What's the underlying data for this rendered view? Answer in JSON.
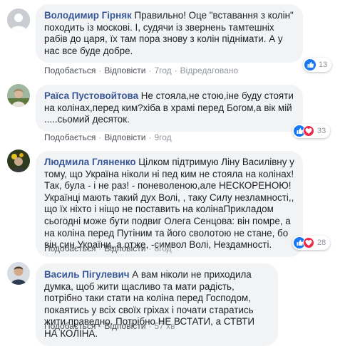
{
  "action_labels": {
    "like": "Подобається",
    "reply": "Відповісти",
    "edited": "Відредаговано"
  },
  "comments": [
    {
      "author": "Володимир Гірняк",
      "text": "Правильно! Оце \"вставання з колін\" походить із москові. І, судячи із звернень тамтешніх рабів до царя, їх там пора знову з колін піднімати. А у нас все буде добре.",
      "time": "7год",
      "edited": true,
      "reactions": {
        "count": "13",
        "types": [
          "like-icon"
        ]
      }
    },
    {
      "author": "Раїса Пустовойтова",
      "text": "Не стояла,не стою,іне буду стояти на колінах,перед ким?хіба в храмі перед Богом,а вік мій .....сьомий десяток.",
      "time": "9год",
      "edited": false,
      "reactions": {
        "count": "33",
        "types": [
          "like-icon",
          "love-icon"
        ]
      }
    },
    {
      "author": "Людмила Гляненко",
      "text": "Цілком підтримую Ліну Василівну у тому, що Україна ніколи ні пед ким не стояла на колінах! Так, була - і не раз! - поневоленою,але НЕСКОРЕНОЮ! Українці мають такий дух Волі, , таку Силу незламності,, що їх ніхто і ніщо не поставить на колінаПрикладом сьогодні може бути подвиг Олега Сенцова: він помре, а на коліна перед Путіним та його сволотою не стане, бо він син України, а отже, -символ Волі, Нездамності.",
      "time": "8год",
      "edited": false,
      "reactions": {
        "count": "28",
        "types": [
          "like-icon",
          "love-icon"
        ]
      }
    },
    {
      "author": "Василь Пігулевич",
      "text": "А вам ніколи не приходила думка, щоб жити щасливо та мати радість, потрібно таки стати на коліна перед Господом, покаятись у всіх своїх гріхах і почати старатись жити праведно. Потрібно НЕ ВСТАТИ, а СТВТИ НА КОЛІНА.",
      "time": "57 хв",
      "edited": false,
      "reactions": null
    }
  ],
  "colors": {
    "author": "#385898",
    "bubble": "#f2f3f5",
    "like": "#1877f2",
    "love": "#f0284a"
  }
}
